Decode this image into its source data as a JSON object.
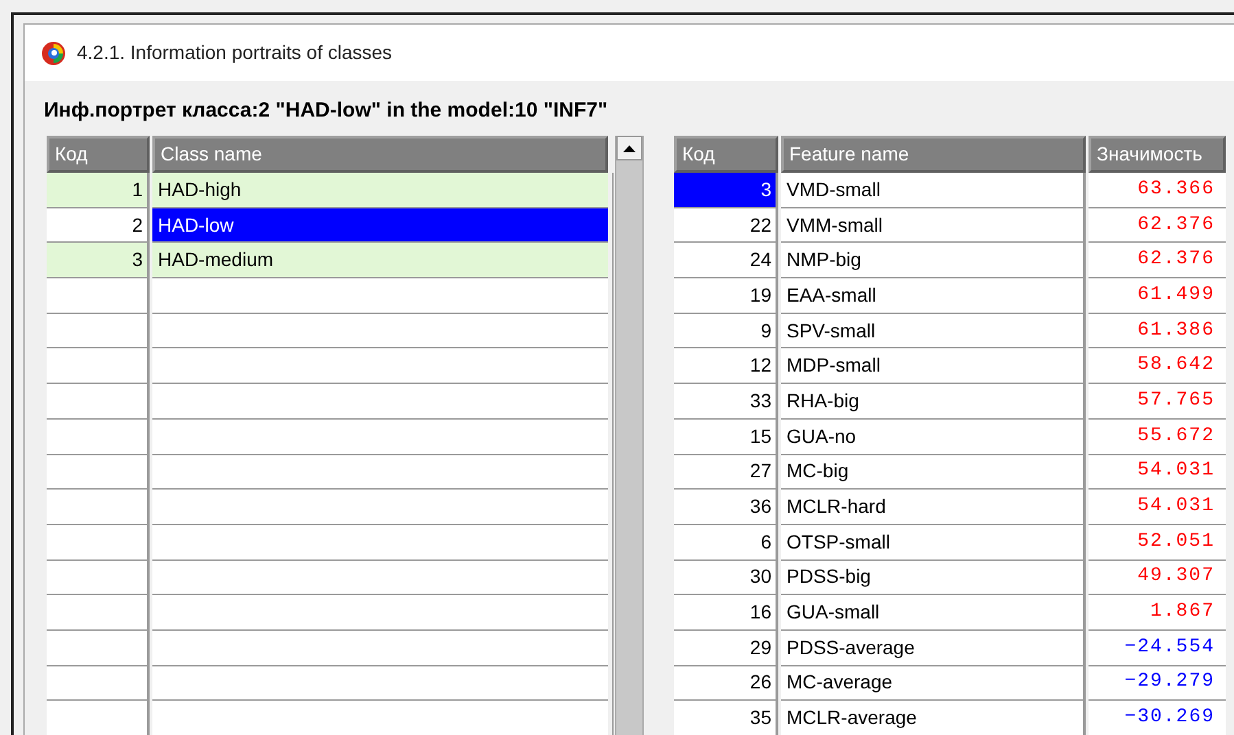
{
  "window": {
    "title": "4.2.1. Information portraits of classes"
  },
  "heading": "Инф.портрет класса:2 \"HAD-low\" in the model:10 \"INF7\"",
  "classes_table": {
    "columns": [
      "Код",
      "Class name"
    ],
    "rows": [
      {
        "code": "1",
        "name": "HAD-high",
        "selected": false
      },
      {
        "code": "2",
        "name": "HAD-low",
        "selected": true
      },
      {
        "code": "3",
        "name": "HAD-medium",
        "selected": false
      }
    ]
  },
  "features_table": {
    "columns": [
      "Код",
      "Feature name",
      "Значимость"
    ],
    "rows": [
      {
        "code": "3",
        "name": "VMD-small",
        "value": "63.366",
        "color": "#ff0000",
        "selected": true
      },
      {
        "code": "22",
        "name": "VMM-small",
        "value": "62.376",
        "color": "#ff0000",
        "selected": false
      },
      {
        "code": "24",
        "name": "NMP-big",
        "value": "62.376",
        "color": "#ff0000",
        "selected": false
      },
      {
        "code": "19",
        "name": "EAA-small",
        "value": "61.499",
        "color": "#ff0000",
        "selected": false
      },
      {
        "code": "9",
        "name": "SPV-small",
        "value": "61.386",
        "color": "#ff0000",
        "selected": false
      },
      {
        "code": "12",
        "name": "MDP-small",
        "value": "58.642",
        "color": "#ff0000",
        "selected": false
      },
      {
        "code": "33",
        "name": "RHA-big",
        "value": "57.765",
        "color": "#ff0000",
        "selected": false
      },
      {
        "code": "15",
        "name": "GUA-no",
        "value": "55.672",
        "color": "#ff0000",
        "selected": false
      },
      {
        "code": "27",
        "name": "MC-big",
        "value": "54.031",
        "color": "#ff0000",
        "selected": false
      },
      {
        "code": "36",
        "name": "MCLR-hard",
        "value": "54.031",
        "color": "#ff0000",
        "selected": false
      },
      {
        "code": "6",
        "name": "OTSP-small",
        "value": "52.051",
        "color": "#ff0000",
        "selected": false
      },
      {
        "code": "30",
        "name": "PDSS-big",
        "value": "49.307",
        "color": "#ff0000",
        "selected": false
      },
      {
        "code": "16",
        "name": "GUA-small",
        "value": "1.867",
        "color": "#ff0000",
        "selected": false
      },
      {
        "code": "29",
        "name": "PDSS-average",
        "value": "−24.554",
        "color": "#0000ff",
        "selected": false
      },
      {
        "code": "26",
        "name": "MC-average",
        "value": "−29.279",
        "color": "#0000ff",
        "selected": false
      },
      {
        "code": "35",
        "name": "MCLR-average",
        "value": "−30.269",
        "color": "#0000ff",
        "selected": false
      }
    ]
  }
}
